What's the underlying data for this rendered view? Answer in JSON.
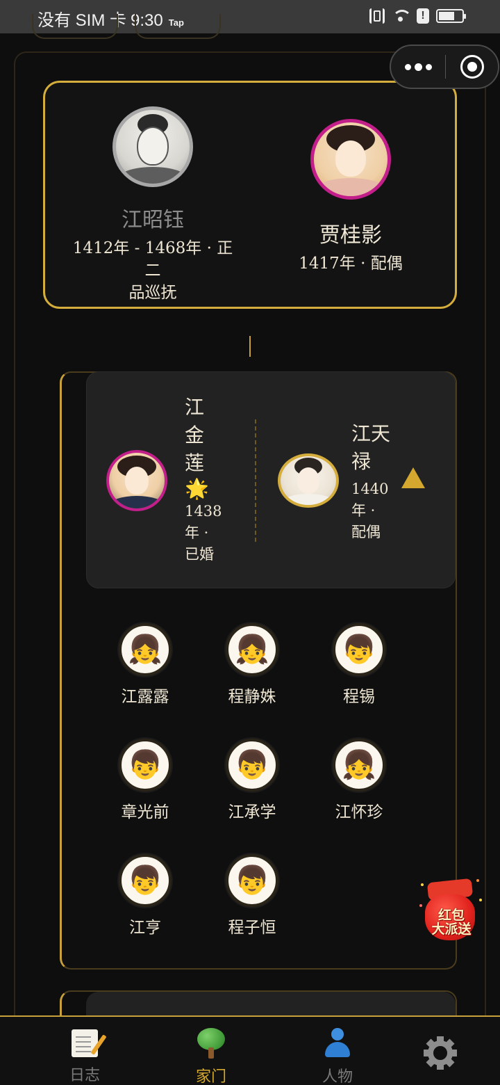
{
  "status_bar": {
    "carrier": "没有 SIM 卡",
    "time": "9:30",
    "tap_label": "Tap",
    "alert_glyph": "!"
  },
  "mini_program_capsule": {
    "more_icon": "more-dots-icon",
    "close_icon": "target-close-icon"
  },
  "parents": {
    "father": {
      "name": "江昭钰",
      "meta_line1": "1412年 - 1468年 · 正二",
      "meta_line2": "品巡抚",
      "status": "deceased",
      "portrait_border": "#a8a8a8"
    },
    "mother": {
      "name": "贾桂影",
      "meta": "1417年 · 配偶",
      "portrait_border": "#c21f8a"
    }
  },
  "child_family": {
    "child": {
      "name_chars": [
        "江",
        "金",
        "莲"
      ],
      "star": "🌟",
      "meta_lines": [
        "1438",
        "年 ·",
        "已婚"
      ]
    },
    "spouse": {
      "name_lines": [
        "江天",
        "禄"
      ],
      "meta_lines": [
        "1440",
        "年 ·",
        "配偶"
      ]
    },
    "expand_icon": "triangle-up-icon"
  },
  "grandchildren": [
    {
      "name": "江露露",
      "emoji": "👧"
    },
    {
      "name": "程静姝",
      "emoji": "👧"
    },
    {
      "name": "程锡",
      "emoji": "👦"
    },
    {
      "name": "章光前",
      "emoji": "👦"
    },
    {
      "name": "江承学",
      "emoji": "👦"
    },
    {
      "name": "江怀珍",
      "emoji": "👧"
    },
    {
      "name": "江亨",
      "emoji": "👦"
    },
    {
      "name": "程子恒",
      "emoji": "👦"
    }
  ],
  "red_packet": {
    "line1": "红包",
    "line2": "大派送"
  },
  "tabbar": {
    "tabs": [
      {
        "label": "日志",
        "icon": "diary-icon",
        "active": false
      },
      {
        "label": "家门",
        "icon": "tree-icon",
        "active": true
      },
      {
        "label": "人物",
        "icon": "person-icon",
        "active": false
      },
      {
        "label": "",
        "icon": "gear-icon",
        "active": false
      }
    ]
  },
  "colors": {
    "accent_gold": "#d4ad3c",
    "female_border": "#c21f8a",
    "background": "#0e0e0e"
  }
}
